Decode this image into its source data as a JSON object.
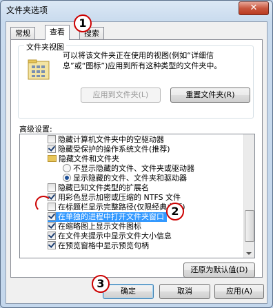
{
  "window": {
    "title": "文件夹选项",
    "close_glyph": "✕"
  },
  "tabs": [
    {
      "label": "常规"
    },
    {
      "label": "查看"
    },
    {
      "label": "搜索"
    }
  ],
  "folder_view": {
    "legend": "文件夹视图",
    "description": "可以将该文件夹正在使用的视图(例如“详细信\n息”或“图标”)应用到所有这种类型的文件夹中。",
    "apply_button": "应用到文件夹(L)",
    "reset_button": "重置文件夹(R)"
  },
  "advanced": {
    "label": "高级设置:",
    "items": [
      {
        "text": "隐藏计算机文件夹中的空驱动器",
        "type": "checkbox",
        "checked": false
      },
      {
        "text": "隐藏受保护的操作系统文件(推荐)",
        "type": "checkbox",
        "checked": true
      },
      {
        "text": "隐藏文件和文件夹",
        "type": "folder"
      },
      {
        "text": "不显示隐藏的文件、文件夹或驱动器",
        "type": "radio",
        "checked": false
      },
      {
        "text": "显示隐藏的文件、文件夹和驱动器",
        "type": "radio",
        "checked": true
      },
      {
        "text": "隐藏已知文件类型的扩展名",
        "type": "checkbox",
        "checked": false
      },
      {
        "text": "用彩色显示加密或压缩的 NTFS 文件",
        "type": "checkbox",
        "checked": true
      },
      {
        "text": "在标题栏显示完整路径(仅限经典主题)",
        "type": "checkbox",
        "checked": false
      },
      {
        "text": "在单独的进程中打开文件夹窗口",
        "type": "checkbox",
        "checked": true
      },
      {
        "text": "在缩略图上显示文件图标",
        "type": "checkbox",
        "checked": true
      },
      {
        "text": "在文件夹提示中显示文件大小信息",
        "type": "checkbox",
        "checked": true
      },
      {
        "text": "在预览窗格中显示预览句柄",
        "type": "checkbox",
        "checked": true
      }
    ],
    "restore_button": "还原为默认值(D)"
  },
  "footer": {
    "ok": "确定",
    "cancel": "取消",
    "apply": "应用(A)"
  },
  "markers": [
    "1",
    "2",
    "3"
  ]
}
